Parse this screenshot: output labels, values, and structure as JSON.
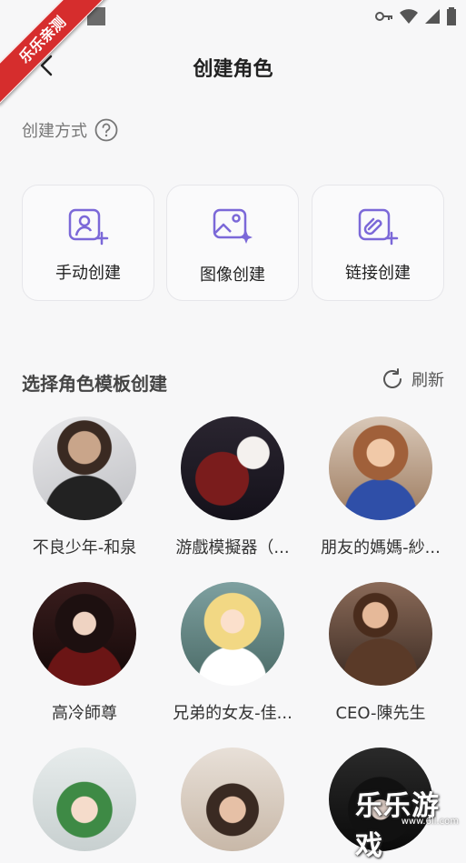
{
  "status_bar": {
    "icons": [
      "key-icon",
      "wifi-icon",
      "signal-icon",
      "battery-icon"
    ]
  },
  "ribbon": {
    "text": "乐乐亲测"
  },
  "header": {
    "title": "创建角色",
    "back_icon": "chevron-left-icon"
  },
  "create_section": {
    "label": "创建方式",
    "help_icon": "help-circle-icon",
    "options": [
      {
        "label": "手动创建",
        "icon": "user-plus-icon"
      },
      {
        "label": "图像创建",
        "icon": "image-sparkle-icon"
      },
      {
        "label": "链接创建",
        "icon": "link-plus-icon"
      }
    ]
  },
  "templates": {
    "title": "选择角色模板创建",
    "refresh_label": "刷新",
    "items": [
      {
        "name": "不良少年-和泉"
      },
      {
        "name": "游戲模擬器（..."
      },
      {
        "name": "朋友的媽媽-紗..."
      },
      {
        "name": "高冷師尊"
      },
      {
        "name": "兄弟的女友-佳..."
      },
      {
        "name": "CEO-陳先生"
      },
      {
        "name": ""
      },
      {
        "name": ""
      },
      {
        "name": ""
      }
    ]
  },
  "watermark": {
    "text": "乐乐游戏",
    "url": "www.6ll.com"
  },
  "colors": {
    "accent": "#7b68d8",
    "background": "#f7f7f8"
  }
}
